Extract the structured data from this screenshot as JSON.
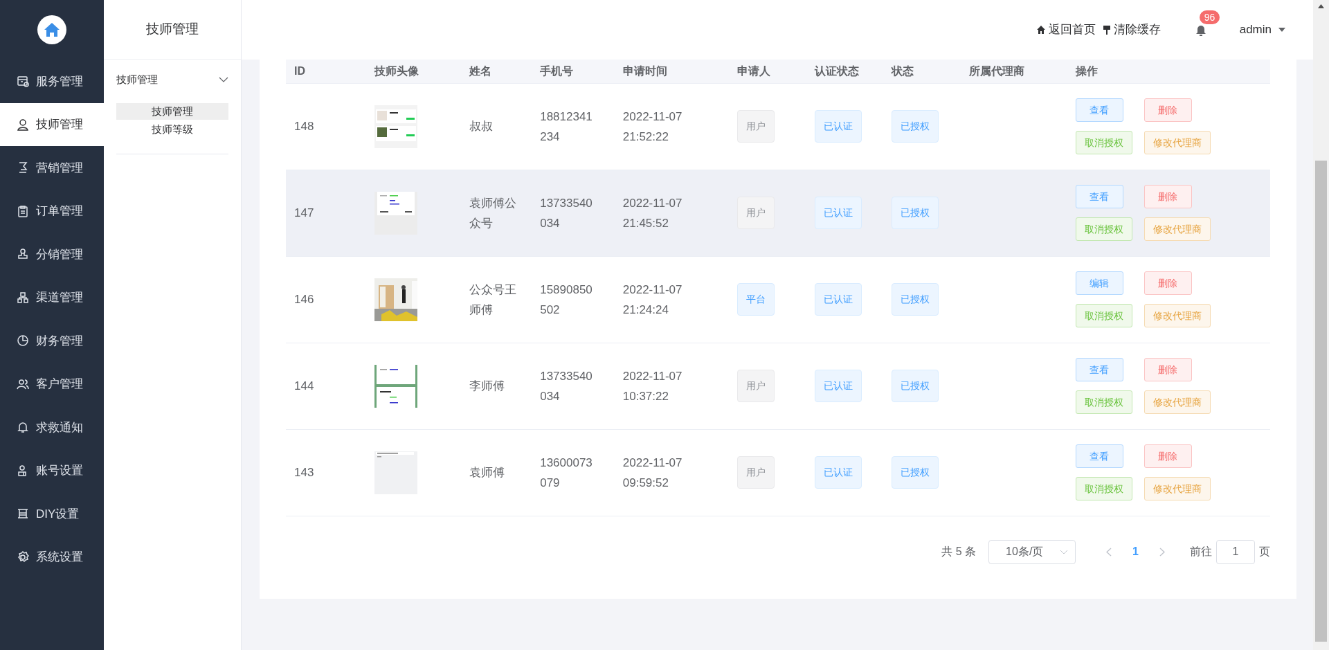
{
  "sidebar": {
    "items": [
      {
        "label": "服务管理",
        "selected": false
      },
      {
        "label": "技师管理",
        "selected": true
      },
      {
        "label": "营销管理",
        "selected": false
      },
      {
        "label": "订单管理",
        "selected": false
      },
      {
        "label": "分销管理",
        "selected": false
      },
      {
        "label": "渠道管理",
        "selected": false
      },
      {
        "label": "财务管理",
        "selected": false
      },
      {
        "label": "客户管理",
        "selected": false
      },
      {
        "label": "求救通知",
        "selected": false
      },
      {
        "label": "账号设置",
        "selected": false
      },
      {
        "label": "DIY设置",
        "selected": false
      },
      {
        "label": "系统设置",
        "selected": false
      }
    ]
  },
  "submenu": {
    "title": "技师管理",
    "groups": [
      {
        "label": "技师管理",
        "expanded": true,
        "children": [
          {
            "label": "技师管理",
            "selected": true
          },
          {
            "label": "技师等级",
            "selected": false
          }
        ]
      }
    ]
  },
  "topbar": {
    "links": [
      "返回首页",
      "清除缓存"
    ],
    "notification_count": "96",
    "user": "admin"
  },
  "table": {
    "columns": [
      "ID",
      "技师头像",
      "姓名",
      "手机号",
      "申请时间",
      "申请人",
      "认证状态",
      "状态",
      "所属代理商",
      "操作"
    ],
    "rows": [
      {
        "id": "148",
        "name": "叔叔",
        "phone": [
          "18812341",
          "234"
        ],
        "time": [
          "2022-11-07",
          "21:52:22"
        ],
        "applicant": {
          "text": "用户",
          "kind": "user"
        },
        "certification": "已认证",
        "status": "已授权",
        "agent": "",
        "hovered": false,
        "actions": [
          {
            "text": "查看",
            "kind": "primary"
          },
          {
            "text": "删除",
            "kind": "danger"
          },
          {
            "text": "取消授权",
            "kind": "success"
          },
          {
            "text": "修改代理商",
            "kind": "warning"
          }
        ]
      },
      {
        "id": "147",
        "name": "袁师傅公众号",
        "phone": [
          "13733540",
          "034"
        ],
        "time": [
          "2022-11-07",
          "21:45:52"
        ],
        "applicant": {
          "text": "用户",
          "kind": "user"
        },
        "certification": "已认证",
        "status": "已授权",
        "hovered": true,
        "actions": [
          {
            "text": "查看",
            "kind": "primary"
          },
          {
            "text": "删除",
            "kind": "danger"
          },
          {
            "text": "取消授权",
            "kind": "success"
          },
          {
            "text": "修改代理商",
            "kind": "warning"
          }
        ]
      },
      {
        "id": "146",
        "name": "公众号王师傅",
        "phone": [
          "15890850",
          "502"
        ],
        "time": [
          "2022-11-07",
          "21:24:24"
        ],
        "applicant": {
          "text": "平台",
          "kind": "platform"
        },
        "certification": "已认证",
        "status": "已授权",
        "hovered": false,
        "actions": [
          {
            "text": "编辑",
            "kind": "primary"
          },
          {
            "text": "删除",
            "kind": "danger"
          },
          {
            "text": "取消授权",
            "kind": "success"
          },
          {
            "text": "修改代理商",
            "kind": "warning"
          }
        ]
      },
      {
        "id": "144",
        "name": "李师傅",
        "phone": [
          "13733540",
          "034"
        ],
        "time": [
          "2022-11-07",
          "10:37:22"
        ],
        "applicant": {
          "text": "用户",
          "kind": "user"
        },
        "certification": "已认证",
        "status": "已授权",
        "hovered": false,
        "actions": [
          {
            "text": "查看",
            "kind": "primary"
          },
          {
            "text": "删除",
            "kind": "danger"
          },
          {
            "text": "取消授权",
            "kind": "success"
          },
          {
            "text": "修改代理商",
            "kind": "warning"
          }
        ]
      },
      {
        "id": "143",
        "name": "袁师傅",
        "phone": [
          "13600073",
          "079"
        ],
        "time": [
          "2022-11-07",
          "09:59:52"
        ],
        "applicant": {
          "text": "用户",
          "kind": "user"
        },
        "certification": "已认证",
        "status": "已授权",
        "hovered": false,
        "actions": [
          {
            "text": "查看",
            "kind": "primary"
          },
          {
            "text": "删除",
            "kind": "danger"
          },
          {
            "text": "取消授权",
            "kind": "success"
          },
          {
            "text": "修改代理商",
            "kind": "warning"
          }
        ]
      }
    ]
  },
  "pagination": {
    "total": "共 5 条",
    "page_size": "10条/页",
    "pages": [
      {
        "label": "1",
        "selected": true
      }
    ],
    "goto_label": "前往",
    "goto_value": "1",
    "goto_suffix": "页"
  }
}
